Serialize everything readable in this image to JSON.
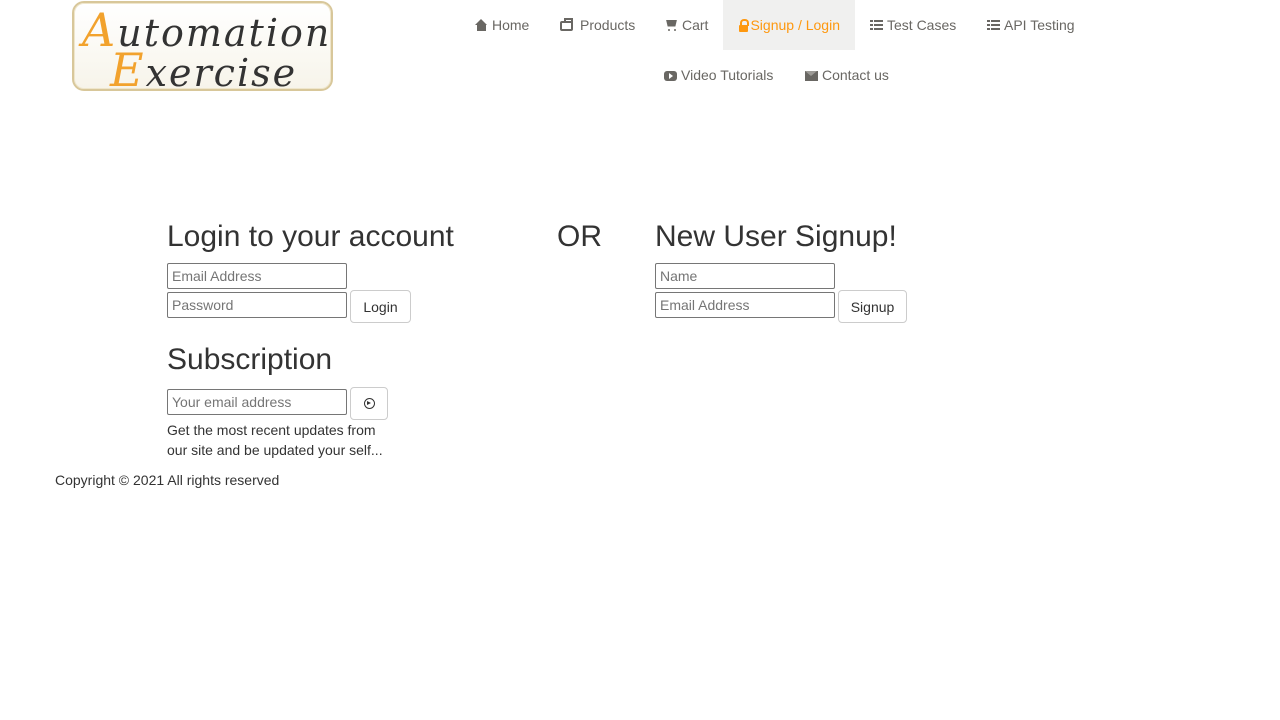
{
  "logo": {
    "line1_initial": "A",
    "line1_rest": "utomation",
    "line2_initial": "E",
    "line2_rest": "xercise",
    "accent_color": "#f2a22d"
  },
  "nav": {
    "active_color": "#fe980f",
    "items": [
      {
        "label": "Home",
        "icon": "home-icon"
      },
      {
        "label": "Products",
        "icon": "briefcase-icon"
      },
      {
        "label": "Cart",
        "icon": "cart-icon"
      },
      {
        "label": "Signup / Login",
        "icon": "lock-icon",
        "active": true
      },
      {
        "label": "Test Cases",
        "icon": "list-icon"
      },
      {
        "label": "API Testing",
        "icon": "list-icon"
      },
      {
        "label": "Video Tutorials",
        "icon": "youtube-icon"
      },
      {
        "label": "Contact us",
        "icon": "envelope-icon"
      }
    ]
  },
  "login": {
    "title": "Login to your account",
    "email_placeholder": "Email Address",
    "password_placeholder": "Password",
    "button_label": "Login"
  },
  "divider": "OR",
  "signup": {
    "title": "New User Signup!",
    "name_placeholder": "Name",
    "email_placeholder": "Email Address",
    "button_label": "Signup"
  },
  "subscription": {
    "title": "Subscription",
    "email_placeholder": "Your email address",
    "description_line1": "Get the most recent updates from",
    "description_line2": "our site and be updated your self..."
  },
  "footer": {
    "copyright": "Copyright © 2021 All rights reserved"
  }
}
